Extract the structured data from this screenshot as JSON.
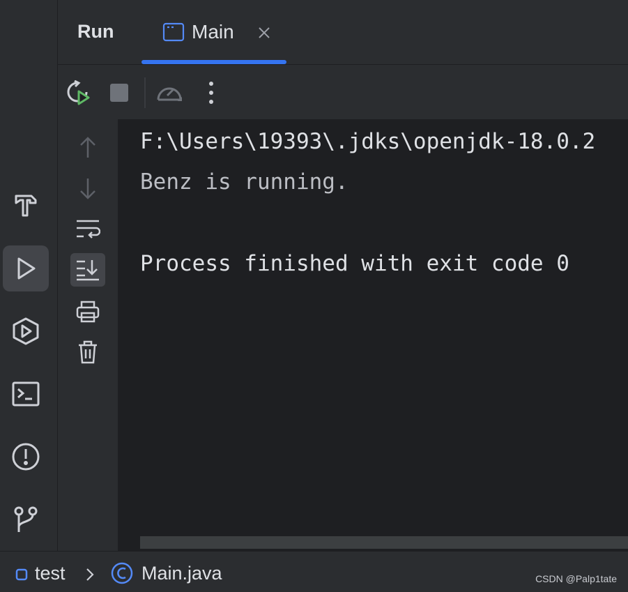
{
  "tool_window": {
    "title": "Run",
    "tab": {
      "label": "Main",
      "icon": "application-icon"
    }
  },
  "toolbar": {
    "icons": [
      "rerun-icon",
      "stop-icon",
      "profiler-icon",
      "more-options-icon"
    ]
  },
  "left_strip": {
    "icons": [
      "build-hammer-icon",
      "run-icon",
      "services-icon",
      "terminal-icon",
      "problems-icon",
      "git-icon"
    ],
    "active": "run-icon"
  },
  "side_actions": {
    "icons": [
      "scroll-up-icon",
      "scroll-down-icon",
      "soft-wrap-icon",
      "scroll-to-end-icon",
      "print-icon",
      "trash-icon"
    ],
    "active": "scroll-to-end-icon"
  },
  "console": {
    "lines": [
      {
        "text": "F:\\Users\\19393\\.jdks\\openjdk-18.0.2",
        "color": "#dfe1e5"
      },
      {
        "text": "Benz is running.",
        "color": "#bcbec4"
      },
      {
        "text": "",
        "color": "#bcbec4"
      },
      {
        "text": "Process finished with exit code 0",
        "color": "#dfe1e5"
      }
    ]
  },
  "status_bar": {
    "module": "test",
    "file": "Main.java",
    "file_icon": "class-icon"
  },
  "watermark": "CSDN @Palp1tate",
  "colors": {
    "accent": "#3574f0",
    "run_green": "#5fb865",
    "panel": "#2b2d30",
    "console_bg": "#1e1f22"
  }
}
